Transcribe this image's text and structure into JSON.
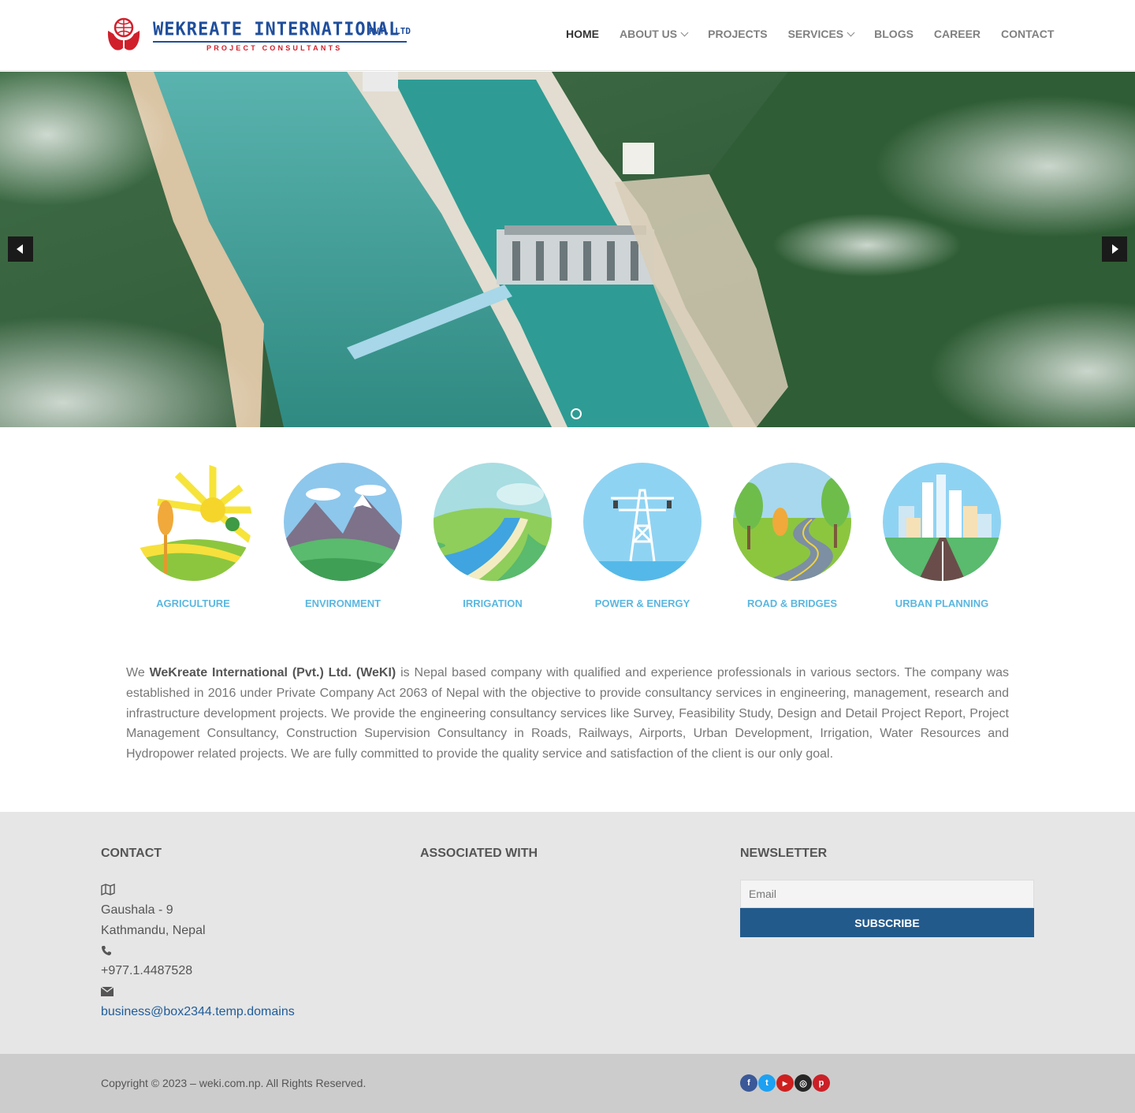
{
  "header": {
    "logo_title": "WEKREATE INTERNATIONAL",
    "logo_suffix": "PVT. LTD",
    "logo_subtitle": "PROJECT CONSULTANTS",
    "nav": [
      {
        "label": "HOME",
        "active": true
      },
      {
        "label": "ABOUT US",
        "dropdown": true
      },
      {
        "label": "PROJECTS"
      },
      {
        "label": "SERVICES",
        "dropdown": true
      },
      {
        "label": "BLOGS"
      },
      {
        "label": "CAREER"
      },
      {
        "label": "CONTACT"
      }
    ]
  },
  "services": [
    {
      "label": "AGRICULTURE",
      "icon": "agriculture-icon"
    },
    {
      "label": "ENVIRONMENT",
      "icon": "mountain-icon"
    },
    {
      "label": "IRRIGATION",
      "icon": "river-icon"
    },
    {
      "label": "POWER & ENERGY",
      "icon": "power-tower-icon"
    },
    {
      "label": "ROAD & BRIDGES",
      "icon": "road-icon"
    },
    {
      "label": "URBAN PLANNING",
      "icon": "city-icon"
    }
  ],
  "about": {
    "prefix": "We ",
    "company": "WeKreate International (Pvt.) Ltd. (WeKI)",
    "body": " is Nepal based company with qualified and experience professionals in various sectors. The company was established in 2016 under Private Company Act 2063 of Nepal with the objective to provide consultancy services in engineering, management, research and infrastructure development projects. We provide the engineering consultancy services like Survey, Feasibility Study, Design and Detail Project Report, Project Management Consultancy, Construction Supervision Consultancy in Roads, Railways, Airports, Urban Development, Irrigation, Water Resources and Hydropower related projects. We are fully committed to provide the quality service and satisfaction of the client is our only goal."
  },
  "footer": {
    "contact_heading": "CONTACT",
    "associated_heading": "ASSOCIATED WITH",
    "newsletter_heading": "NEWSLETTER",
    "address_line1": "Gaushala - 9",
    "address_line2": "Kathmandu, Nepal",
    "phone": "+977.1.4487528",
    "email": "business@box2344.temp.domains",
    "email_placeholder": "Email",
    "subscribe_label": "SUBSCRIBE",
    "copyright": "Copyright © 2023 – weki.com.np. All Rights Reserved.",
    "socials": [
      {
        "name": "facebook-icon",
        "glyph": "f",
        "color": "#3b5998"
      },
      {
        "name": "twitter-icon",
        "glyph": "t",
        "color": "#1da1f2"
      },
      {
        "name": "youtube-icon",
        "glyph": "▶",
        "color": "#cd201f"
      },
      {
        "name": "instagram-icon",
        "glyph": "◎",
        "color": "#262626"
      },
      {
        "name": "pinterest-icon",
        "glyph": "p",
        "color": "#cb2027"
      }
    ]
  }
}
